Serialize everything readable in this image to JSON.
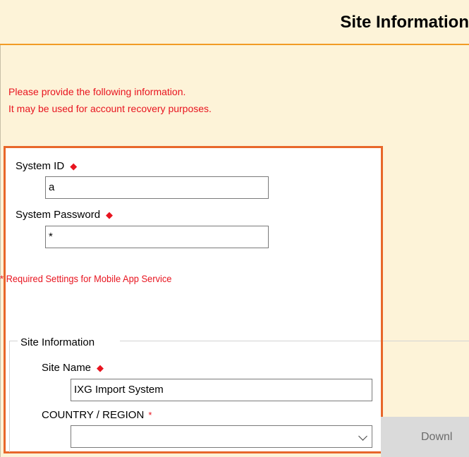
{
  "header": {
    "title": "Site Information"
  },
  "notice": {
    "line1": "Please provide the following information.",
    "line2": "It may be used for account recovery purposes."
  },
  "mobile_app": {
    "system_id_label": "System ID",
    "system_id_value": "a",
    "system_password_label": "System Password",
    "system_password_value": "*",
    "required_marker": "◆",
    "required_note": "* Required Settings for Mobile App Service"
  },
  "site_info": {
    "group_label": "Site Information",
    "site_name_label": "Site Name",
    "site_name_value": "IXG Import System",
    "country_label": "COUNTRY / REGION",
    "country_required": "*",
    "country_value": ""
  },
  "download_button": {
    "label": "Downl"
  },
  "colors": {
    "header_bg": "#fdf3d8",
    "accent_orange": "#f29b25",
    "highlight_border": "#e8672a",
    "required_red": "#e8141f"
  },
  "icons": {
    "required": "diamond-icon",
    "dropdown": "chevron-down-icon"
  }
}
